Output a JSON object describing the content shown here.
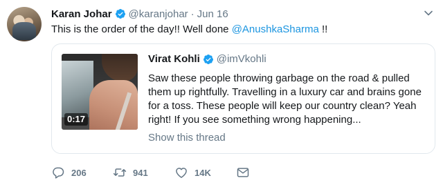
{
  "tweet": {
    "author_name": "Karan Johar",
    "author_handle": "@karanjohar",
    "separator": "·",
    "date": "Jun 16",
    "text_before": "This is the order of the day!! Well done ",
    "mention": "@AnushkaSharma",
    "text_after": " !!"
  },
  "quoted": {
    "author_name": "Virat Kohli",
    "author_handle": "@imVkohli",
    "text": "Saw these people throwing garbage on the road & pulled them up rightfully. Travelling in a luxury car and brains gone for a toss. These people will keep our country clean? Yeah right! If you see something wrong happening...",
    "video_duration": "0:17",
    "show_thread": "Show this thread"
  },
  "actions": {
    "reply_count": "206",
    "retweet_count": "941",
    "like_count": "14K"
  },
  "colors": {
    "text": "#14171a",
    "secondary": "#657786",
    "link": "#1b95e0",
    "verified": "#1da1f2",
    "border": "#e1e8ed"
  },
  "icons": [
    "verified-badge-icon",
    "chevron-down-icon",
    "reply-icon",
    "retweet-icon",
    "like-icon",
    "direct-message-icon"
  ]
}
